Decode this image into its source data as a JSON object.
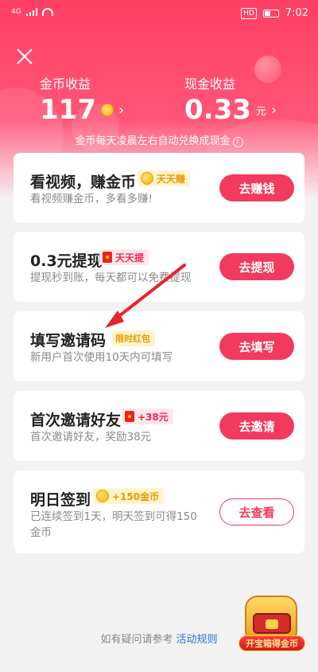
{
  "status_bar": {
    "network": "4G",
    "hd_label": "HD",
    "time": "7:02"
  },
  "header": {
    "coin_income_label": "金币收益",
    "coin_income_value": "117",
    "cash_income_label": "现金收益",
    "cash_income_value": "0.33",
    "cash_unit": "元",
    "chevron": "›",
    "notice": "金币每天凌晨左右自动兑换成现金",
    "info_glyph": "i"
  },
  "tasks": [
    {
      "title": "看视频，赚金币",
      "tag": "天天赚",
      "tag_icon": "coin-icon",
      "description": "看视频赚金币，多看多赚!",
      "button": "去赚钱"
    },
    {
      "title": "0.3元提现",
      "tag": "天天提",
      "tag_icon": "red-envelope-icon",
      "description": "提现秒到账，每天都可以免费提现",
      "button": "去提现"
    },
    {
      "title": "填写邀请码",
      "tag": "限时红包",
      "description": "新用户首次使用10天内可填写",
      "button": "去填写"
    },
    {
      "title": "首次邀请好友",
      "tag": "+38元",
      "tag_icon": "red-envelope-icon",
      "description": "首次邀请好友，奖励38元",
      "button": "去邀请"
    },
    {
      "title": "明日签到",
      "tag": "+150金币",
      "tag_icon": "coin-icon",
      "description_line1": "已连续签到1天，明天签到可得150",
      "description_line2": "金币",
      "button": "去查看"
    }
  ],
  "footer": {
    "text": "如有疑问请参考",
    "link": "活动规则"
  },
  "treasure": {
    "label": "开宝箱得金币"
  },
  "colors": {
    "accent": "#f23a5e",
    "header_top": "#ff3f63",
    "link": "#2c6fd6",
    "tag_yellow_text": "#e89a00"
  }
}
